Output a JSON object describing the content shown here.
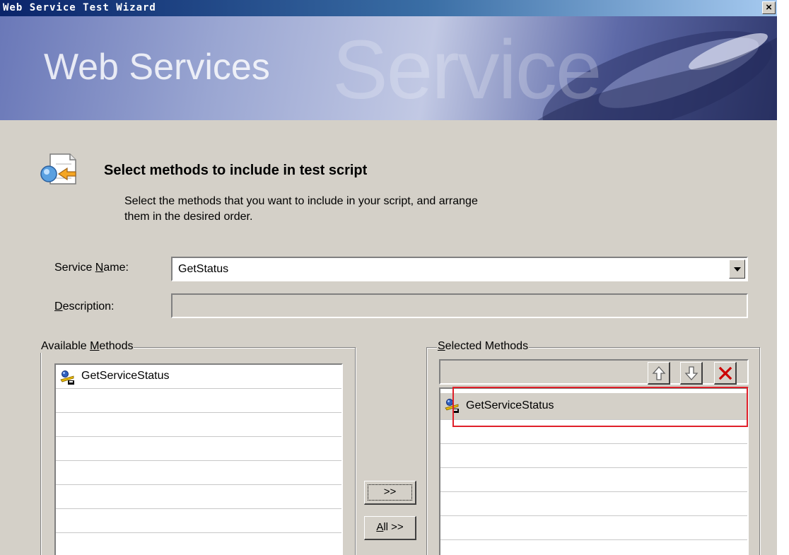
{
  "window": {
    "title": "Web Service Test Wizard",
    "close_glyph": "×"
  },
  "banner": {
    "title": "Web Services",
    "watermark": "Service"
  },
  "header": {
    "icon": "service-arrow-icon",
    "heading": "Select methods to include in test script",
    "subtext_line1": "Select the methods that you want to include in your script, and arrange",
    "subtext_line2": "them in the desired order."
  },
  "form": {
    "service_name_label_pre": "Service ",
    "service_name_label_key": "N",
    "service_name_label_post": "ame:",
    "service_name_value": "GetStatus",
    "description_label_key": "D",
    "description_label_post": "escription:",
    "description_value": ""
  },
  "available": {
    "label_pre": "Available ",
    "label_key": "M",
    "label_post": "ethods",
    "items": [
      "GetServiceStatus"
    ]
  },
  "transfer": {
    "add_label": ">>",
    "all_key": "A",
    "all_post": "ll >>"
  },
  "selected": {
    "label_key": "S",
    "label_post": "elected Methods",
    "items": [
      "GetServiceStatus"
    ],
    "toolbar_icons": [
      "move-up-icon",
      "move-down-icon",
      "delete-icon"
    ]
  },
  "colors": {
    "highlight": "#e0202a",
    "delete": "#cc0000",
    "titlebar_start": "#0a246a"
  }
}
